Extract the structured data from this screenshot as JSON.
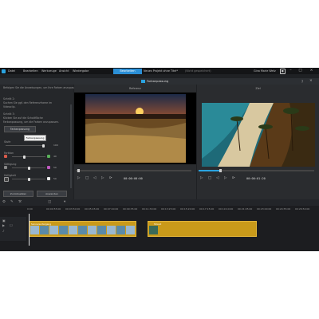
{
  "menubar": {
    "items": [
      "Datei",
      "Bearbeiten",
      "Werkzeuge",
      "Ansicht",
      "Wiedergabe"
    ],
    "edit_tab": "Bearbeiten",
    "project": "Neues Projekt ohne Titel*",
    "saved_status": "(Nicht gespeichert)",
    "user": "Gina Marie Wetz"
  },
  "dialog": {
    "title": "Farbanpassung",
    "help": "?",
    "close": "×"
  },
  "left_panel": {
    "intro": "Befolgen Sie die Anweisungen, um Ihre Farben anzupassen:",
    "step2_title": "Schritt 2:",
    "step2_text1": "Suchen Sie ggf. den Referenzframe im",
    "step2_text2": "Videoclip.",
    "step3_title": "Schritt 3:",
    "step3_text1": "Klicken Sie auf die Schaltfläche",
    "step3_text2": "Farbanpassung, um die Farben anzupassen.",
    "match_button": "Farbanpassung",
    "tooltip": "Farbanpassung",
    "sliders": [
      {
        "label": "Stufe",
        "value": "100"
      },
      {
        "label": "Farbton",
        "value": "40"
      },
      {
        "label": "Sättigung",
        "value": "50"
      },
      {
        "label": "Helligkeit",
        "value": "50"
      }
    ],
    "reset_button": "Zurücksetzen",
    "apply_button": "Anwenden"
  },
  "reference_pane": {
    "header": "Referenz",
    "timecode": "00:00:00:00"
  },
  "target_pane": {
    "header": "Ziel",
    "timecode": "00:00:01:20"
  },
  "timeline": {
    "ruler": [
      "0:00",
      "00:00:55:00",
      "00:03:50:00",
      "00:05:45:00",
      "00:07:40:00",
      "00:09:35:00",
      "00:11:30:00",
      "00:13:25:00",
      "00:15:20:00",
      "00:17:15:00",
      "00:19:10:00",
      "00:21:05:00",
      "00:23:00:00",
      "00:24:55:00",
      "00:26:50:00"
    ],
    "clip1_name": "Sonnenuntergang",
    "clip2_name": "Strand"
  },
  "colors": {
    "accent": "#2b8fd6",
    "clip": "#c99a1a",
    "background": "#1f2124"
  }
}
